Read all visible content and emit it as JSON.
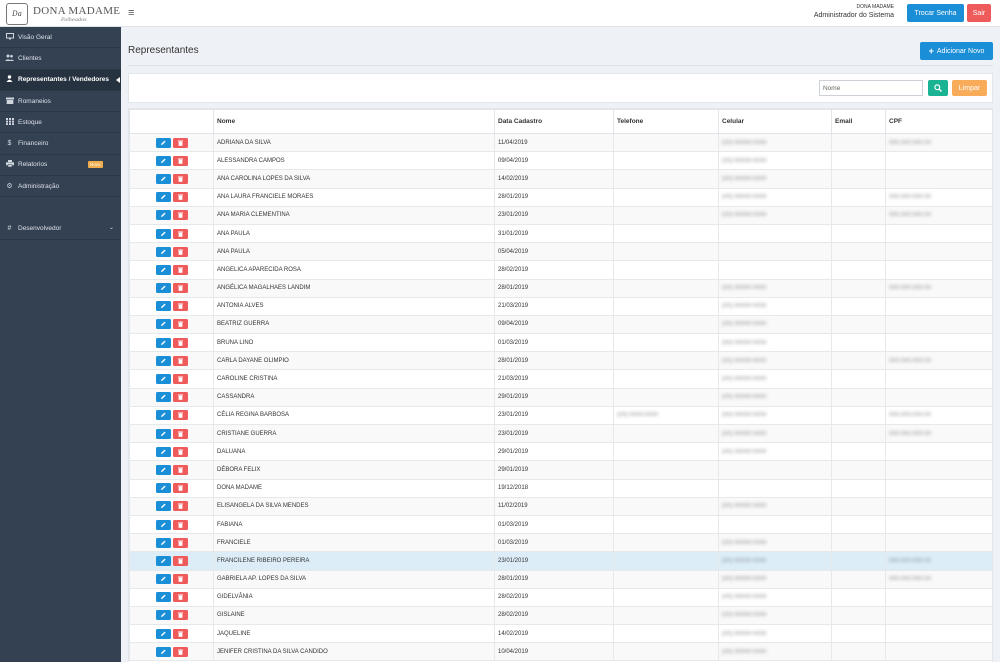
{
  "brand": {
    "name": "DONA MADAME",
    "subtitle": "Folheados",
    "emblem": "Da"
  },
  "header": {
    "company": "DONA MADAME",
    "role": "Administrador do Sistema",
    "change_password": "Trocar Senha",
    "logout": "Sair"
  },
  "sidebar": {
    "items": [
      {
        "label": "Visão Geral",
        "icon": "monitor-icon"
      },
      {
        "label": "Clientes",
        "icon": "users-icon"
      },
      {
        "label": "Representantes / Vendedores",
        "icon": "user-icon",
        "active": true
      },
      {
        "label": "Romaneios",
        "icon": "archive-icon"
      },
      {
        "label": "Estoque",
        "icon": "grid-icon"
      },
      {
        "label": "Financeiro",
        "icon": "dollar-icon"
      },
      {
        "label": "Relatorios",
        "icon": "print-icon",
        "badge": "Novo"
      },
      {
        "label": "Administração",
        "icon": "gear-icon"
      }
    ],
    "dev": {
      "label": "Desenvolvedor",
      "icon": "hash-icon"
    }
  },
  "main": {
    "title": "Representantes",
    "add_button": "Adicionar Novo",
    "search": {
      "placeholder": "Nome",
      "clear": "Limpar"
    }
  },
  "table": {
    "columns": [
      "",
      "Nome",
      "Data Cadastro",
      "Telefone",
      "Celular",
      "Email",
      "CPF"
    ],
    "highlight_index": 23,
    "rows": [
      {
        "nome": "ADRIANA DA SILVA",
        "data": "11/04/2019",
        "telefone": "",
        "celular": "(00) 00000-0000",
        "email": "",
        "cpf": "000.000.000-00"
      },
      {
        "nome": "ALESSANDRA CAMPOS",
        "data": "09/04/2019",
        "telefone": "",
        "celular": "(00) 00000-0000",
        "email": "",
        "cpf": ""
      },
      {
        "nome": "ANA CAROLINA LOPES DA SILVA",
        "data": "14/02/2019",
        "telefone": "",
        "celular": "(00) 00000-0000",
        "email": "",
        "cpf": ""
      },
      {
        "nome": "ANA LAURA FRANCIELE MORAES",
        "data": "28/01/2019",
        "telefone": "",
        "celular": "(00) 00000-0000",
        "email": "",
        "cpf": "000.000.000-00"
      },
      {
        "nome": "ANA MARIA CLEMENTINA",
        "data": "23/01/2019",
        "telefone": "",
        "celular": "(00) 00000-0000",
        "email": "",
        "cpf": "000.000.000-00"
      },
      {
        "nome": "ANA PAULA",
        "data": "31/01/2019",
        "telefone": "",
        "celular": "",
        "email": "",
        "cpf": ""
      },
      {
        "nome": "ANA PAULA",
        "data": "05/04/2019",
        "telefone": "",
        "celular": "",
        "email": "",
        "cpf": ""
      },
      {
        "nome": "ANGELICA APARECIDA ROSA",
        "data": "28/02/2019",
        "telefone": "",
        "celular": "",
        "email": "",
        "cpf": ""
      },
      {
        "nome": "ANGÉLICA MAGALHAES LANDIM",
        "data": "28/01/2019",
        "telefone": "",
        "celular": "(00) 00000-0000",
        "email": "",
        "cpf": "000.000.000-00"
      },
      {
        "nome": "ANTONIA ALVES",
        "data": "21/03/2019",
        "telefone": "",
        "celular": "(00) 00000-0000",
        "email": "",
        "cpf": ""
      },
      {
        "nome": "BEATRIZ GUERRA",
        "data": "09/04/2019",
        "telefone": "",
        "celular": "(00) 00000-0000",
        "email": "",
        "cpf": ""
      },
      {
        "nome": "BRUNA LINO",
        "data": "01/03/2019",
        "telefone": "",
        "celular": "(00) 00000-0000",
        "email": "",
        "cpf": ""
      },
      {
        "nome": "CARLA DAYANE OLIMPIO",
        "data": "28/01/2019",
        "telefone": "",
        "celular": "(00) 00000-0000",
        "email": "",
        "cpf": "000.000.000-00"
      },
      {
        "nome": "CAROLINE CRISTINA",
        "data": "21/03/2019",
        "telefone": "",
        "celular": "(00) 00000-0000",
        "email": "",
        "cpf": ""
      },
      {
        "nome": "CASSANDRA",
        "data": "29/01/2019",
        "telefone": "",
        "celular": "(00) 00000-0000",
        "email": "",
        "cpf": ""
      },
      {
        "nome": "CÉLIA REGINA BARBOSA",
        "data": "23/01/2019",
        "telefone": "(00) 0000-0000",
        "celular": "(00) 00000-0000",
        "email": "",
        "cpf": "000.000.000-00"
      },
      {
        "nome": "CRISTIANE GUERRA",
        "data": "23/01/2019",
        "telefone": "",
        "celular": "(00) 00000-0000",
        "email": "",
        "cpf": "000.000.000-00"
      },
      {
        "nome": "DALUANA",
        "data": "29/01/2019",
        "telefone": "",
        "celular": "(00) 00000-0000",
        "email": "",
        "cpf": ""
      },
      {
        "nome": "DÉBORA FELIX",
        "data": "29/01/2019",
        "telefone": "",
        "celular": "",
        "email": "",
        "cpf": ""
      },
      {
        "nome": "DONA MADAME",
        "data": "19/12/2018",
        "telefone": "",
        "celular": "",
        "email": "",
        "cpf": ""
      },
      {
        "nome": "ELISANGELA DA SILVA MENDES",
        "data": "11/02/2019",
        "telefone": "",
        "celular": "(00) 00000-0000",
        "email": "",
        "cpf": ""
      },
      {
        "nome": "FABIANA",
        "data": "01/03/2019",
        "telefone": "",
        "celular": "",
        "email": "",
        "cpf": ""
      },
      {
        "nome": "FRANCIELE",
        "data": "01/03/2019",
        "telefone": "",
        "celular": "(00) 00000-0000",
        "email": "",
        "cpf": ""
      },
      {
        "nome": "FRANCILENE RIBEIRO PEREIRA",
        "data": "23/01/2019",
        "telefone": "",
        "celular": "(00) 00000-0000",
        "email": "",
        "cpf": "000.000.000-00"
      },
      {
        "nome": "GABRIELA AP. LOPES DA SILVA",
        "data": "28/01/2019",
        "telefone": "",
        "celular": "(00) 00000-0000",
        "email": "",
        "cpf": "000.000.000-00"
      },
      {
        "nome": "GIDELVÂNIA",
        "data": "28/02/2019",
        "telefone": "",
        "celular": "(00) 00000-0000",
        "email": "",
        "cpf": ""
      },
      {
        "nome": "GISLAINE",
        "data": "28/02/2019",
        "telefone": "",
        "celular": "(00) 00000-0000",
        "email": "",
        "cpf": ""
      },
      {
        "nome": "JAQUELINE",
        "data": "14/02/2019",
        "telefone": "",
        "celular": "(00) 00000-0000",
        "email": "",
        "cpf": ""
      },
      {
        "nome": "JENIFER CRISTINA DA SILVA CANDIDO",
        "data": "10/04/2019",
        "telefone": "",
        "celular": "(00) 00000-0000",
        "email": "",
        "cpf": ""
      }
    ]
  },
  "colors": {
    "primary": "#1a8fd8",
    "danger": "#ef5b5b",
    "success": "#1ab394",
    "warning": "#f8ac59",
    "sidebar": "#344153",
    "highlight": "#dcedf8"
  }
}
